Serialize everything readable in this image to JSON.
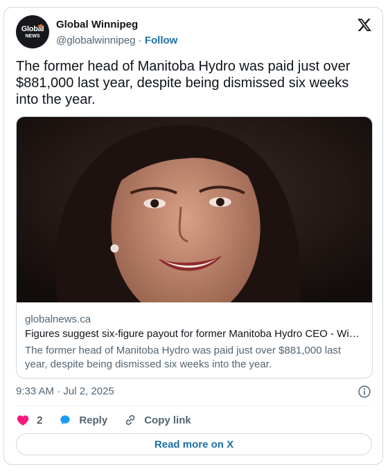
{
  "author": {
    "display_name": "Global Winnipeg",
    "handle": "@globalwinnipeg",
    "separator": "·",
    "follow_label": "Follow",
    "avatar_line1": "Global",
    "avatar_line2": "NEWS"
  },
  "platform_icon": "x-logo-icon",
  "tweet": {
    "text": "The former head of Manitoba Hydro was paid just over $881,000 last year, despite being dismissed six weeks into the year."
  },
  "link_card": {
    "image": "portrait-photo",
    "domain": "globalnews.ca",
    "headline": "Figures suggest six-figure payout for former Manitoba Hydro CEO - Winnipeg",
    "description": "The former head of Manitoba Hydro was paid just over $881,000 last year, despite being dismissed six weeks into the year."
  },
  "meta": {
    "timestamp": "9:33 AM · Jul 2, 2025",
    "info_icon": "info-icon"
  },
  "actions": {
    "like_count": "2",
    "reply_label": "Reply",
    "copy_link_label": "Copy link"
  },
  "read_more_label": "Read more on X",
  "colors": {
    "accent": "#1d6fa5",
    "like": "#f91880",
    "muted": "#536471",
    "border": "#cfd9de"
  }
}
